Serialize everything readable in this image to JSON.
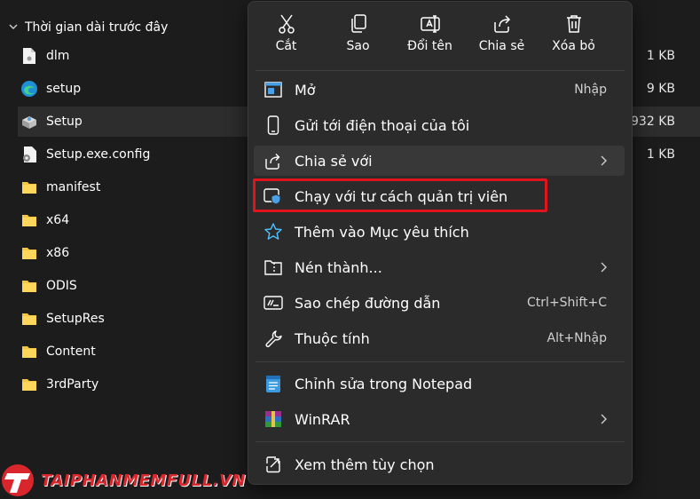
{
  "explorer": {
    "group_label": "Thời gian dài trước đây",
    "files": [
      {
        "name": "dlm",
        "size": "1 KB",
        "icon": "file-icon"
      },
      {
        "name": "setup",
        "size": "9 KB",
        "icon": "edge-icon"
      },
      {
        "name": "Setup",
        "size": ".932 KB",
        "icon": "installer-icon"
      },
      {
        "name": "Setup.exe.config",
        "size": "1 KB",
        "icon": "config-file-icon"
      },
      {
        "name": "manifest",
        "size": "",
        "icon": "folder-icon"
      },
      {
        "name": "x64",
        "size": "",
        "icon": "folder-icon"
      },
      {
        "name": "x86",
        "size": "",
        "icon": "folder-icon"
      },
      {
        "name": "ODIS",
        "size": "",
        "icon": "folder-icon"
      },
      {
        "name": "SetupRes",
        "size": "",
        "icon": "folder-icon"
      },
      {
        "name": "Content",
        "size": "",
        "icon": "folder-icon"
      },
      {
        "name": "3rdParty",
        "size": "",
        "icon": "folder-icon"
      }
    ]
  },
  "menu": {
    "toolbar": [
      {
        "label": "Cắt",
        "icon": "scissors-icon"
      },
      {
        "label": "Sao",
        "icon": "copy-icon"
      },
      {
        "label": "Đổi tên",
        "icon": "rename-icon"
      },
      {
        "label": "Chia sẻ",
        "icon": "share-icon"
      },
      {
        "label": "Xóa bỏ",
        "icon": "trash-icon"
      }
    ],
    "items": [
      {
        "label": "Mở",
        "shortcut": "Nhập",
        "icon": "open-icon"
      },
      {
        "label": "Gửi tới điện thoại của tôi",
        "shortcut": "",
        "icon": "phone-icon"
      },
      {
        "label": "Chia sẻ với",
        "shortcut": "",
        "icon": "share-with-icon",
        "submenu": true
      },
      {
        "label": "Chạy với tư cách quản trị viên",
        "shortcut": "",
        "icon": "shield-icon"
      },
      {
        "label": "Thêm vào Mục yêu thích",
        "shortcut": "",
        "icon": "star-icon"
      },
      {
        "label": "Nén thành...",
        "shortcut": "",
        "icon": "zip-folder-icon",
        "submenu": true
      },
      {
        "label": "Sao chép đường dẫn",
        "shortcut": "Ctrl+Shift+C",
        "icon": "copy-path-icon"
      },
      {
        "label": "Thuộc tính",
        "shortcut": "Alt+Nhập",
        "icon": "wrench-icon"
      },
      {
        "label": "Chỉnh sửa trong Notepad",
        "shortcut": "",
        "icon": "notepad-icon"
      },
      {
        "label": "WinRAR",
        "shortcut": "",
        "icon": "winrar-icon",
        "submenu": true
      },
      {
        "label": "Xem thêm tùy chọn",
        "shortcut": "",
        "icon": "more-options-icon"
      }
    ]
  },
  "watermark": {
    "text": "TAIPHANMEMFULL.VN"
  },
  "colors": {
    "highlight": "#e0141c",
    "folder": "#f4c542",
    "accent": "#4cc2ff"
  }
}
